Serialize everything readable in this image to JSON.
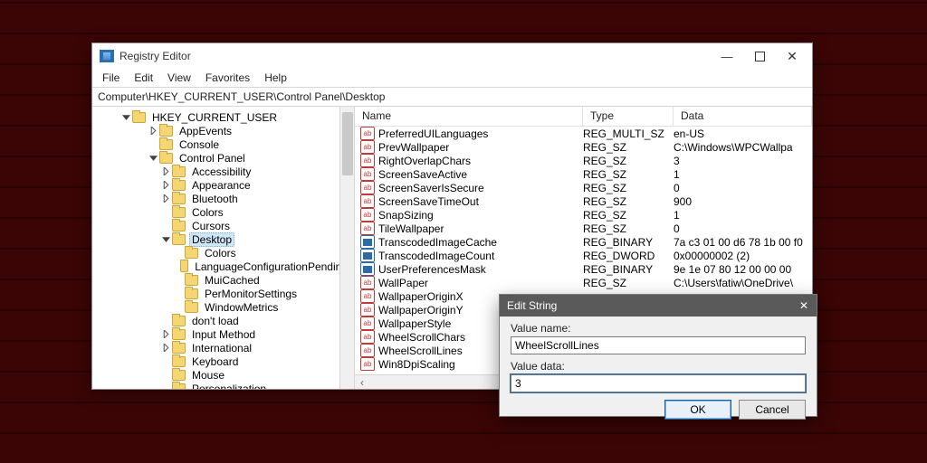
{
  "window": {
    "title": "Registry Editor",
    "address": "Computer\\HKEY_CURRENT_USER\\Control Panel\\Desktop"
  },
  "menu": {
    "file": "File",
    "edit": "Edit",
    "view": "View",
    "favorites": "Favorites",
    "help": "Help"
  },
  "winbtn": {
    "min": "—",
    "close": "✕"
  },
  "tree": {
    "root": {
      "label": "HKEY_CURRENT_USER"
    },
    "items": [
      {
        "label": "AppEvents",
        "indent": 60,
        "twist": "r"
      },
      {
        "label": "Console",
        "indent": 60,
        "twist": ""
      },
      {
        "label": "Control Panel",
        "indent": 60,
        "twist": "d"
      },
      {
        "label": "Accessibility",
        "indent": 74,
        "twist": "r"
      },
      {
        "label": "Appearance",
        "indent": 74,
        "twist": "r"
      },
      {
        "label": "Bluetooth",
        "indent": 74,
        "twist": "r"
      },
      {
        "label": "Colors",
        "indent": 74,
        "twist": ""
      },
      {
        "label": "Cursors",
        "indent": 74,
        "twist": ""
      },
      {
        "label": "Desktop",
        "indent": 74,
        "twist": "d",
        "selected": true
      },
      {
        "label": "Colors",
        "indent": 88,
        "twist": ""
      },
      {
        "label": "LanguageConfigurationPending",
        "indent": 88,
        "twist": ""
      },
      {
        "label": "MuiCached",
        "indent": 88,
        "twist": ""
      },
      {
        "label": "PerMonitorSettings",
        "indent": 88,
        "twist": ""
      },
      {
        "label": "WindowMetrics",
        "indent": 88,
        "twist": ""
      },
      {
        "label": "don't load",
        "indent": 74,
        "twist": ""
      },
      {
        "label": "Input Method",
        "indent": 74,
        "twist": "r"
      },
      {
        "label": "International",
        "indent": 74,
        "twist": "r"
      },
      {
        "label": "Keyboard",
        "indent": 74,
        "twist": ""
      },
      {
        "label": "Mouse",
        "indent": 74,
        "twist": ""
      },
      {
        "label": "Personalization",
        "indent": 74,
        "twist": ""
      }
    ]
  },
  "columns": {
    "name": "Name",
    "type": "Type",
    "data": "Data"
  },
  "values": [
    {
      "name": "PreferredUILanguages",
      "type": "REG_MULTI_SZ",
      "data": "en-US",
      "icon": "str"
    },
    {
      "name": "PrevWallpaper",
      "type": "REG_SZ",
      "data": "C:\\Windows\\WPCWallpa",
      "icon": "str"
    },
    {
      "name": "RightOverlapChars",
      "type": "REG_SZ",
      "data": "3",
      "icon": "str"
    },
    {
      "name": "ScreenSaveActive",
      "type": "REG_SZ",
      "data": "1",
      "icon": "str"
    },
    {
      "name": "ScreenSaverIsSecure",
      "type": "REG_SZ",
      "data": "0",
      "icon": "str"
    },
    {
      "name": "ScreenSaveTimeOut",
      "type": "REG_SZ",
      "data": "900",
      "icon": "str"
    },
    {
      "name": "SnapSizing",
      "type": "REG_SZ",
      "data": "1",
      "icon": "str"
    },
    {
      "name": "TileWallpaper",
      "type": "REG_SZ",
      "data": "0",
      "icon": "str"
    },
    {
      "name": "TranscodedImageCache",
      "type": "REG_BINARY",
      "data": "7a c3 01 00 d6 78 1b 00 f0",
      "icon": "bin"
    },
    {
      "name": "TranscodedImageCount",
      "type": "REG_DWORD",
      "data": "0x00000002 (2)",
      "icon": "bin"
    },
    {
      "name": "UserPreferencesMask",
      "type": "REG_BINARY",
      "data": "9e 1e 07 80 12 00 00 00",
      "icon": "bin"
    },
    {
      "name": "WallPaper",
      "type": "REG_SZ",
      "data": "C:\\Users\\fatiw\\OneDrive\\",
      "icon": "str"
    },
    {
      "name": "WallpaperOriginX",
      "type": "",
      "data": "",
      "icon": "str"
    },
    {
      "name": "WallpaperOriginY",
      "type": "",
      "data": "",
      "icon": "str"
    },
    {
      "name": "WallpaperStyle",
      "type": "",
      "data": "",
      "icon": "str"
    },
    {
      "name": "WheelScrollChars",
      "type": "",
      "data": "",
      "icon": "str"
    },
    {
      "name": "WheelScrollLines",
      "type": "",
      "data": "",
      "icon": "str"
    },
    {
      "name": "Win8DpiScaling",
      "type": "",
      "data": "",
      "icon": "str"
    }
  ],
  "dialog": {
    "title": "Edit String",
    "value_name_label": "Value name:",
    "value_name": "WheelScrollLines",
    "value_data_label": "Value data:",
    "value_data": "3",
    "ok": "OK",
    "cancel": "Cancel",
    "close": "✕"
  }
}
